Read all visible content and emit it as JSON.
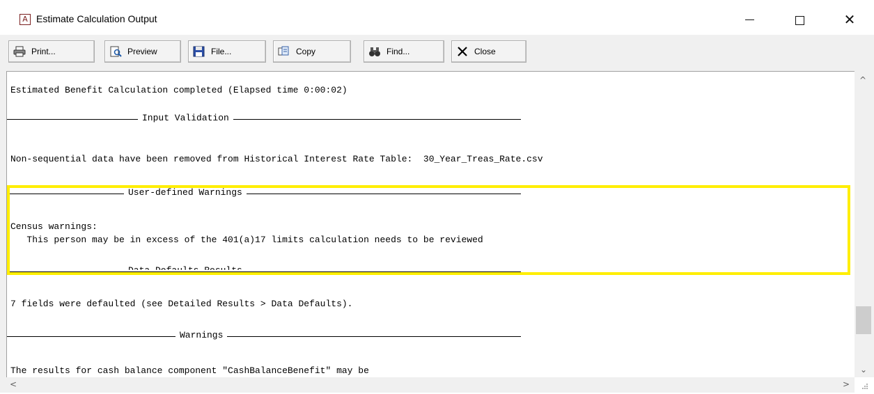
{
  "window": {
    "title": "Estimate Calculation Output",
    "app_icon_letter": "A",
    "controls": {
      "minimize": "minimize",
      "maximize": "maximize",
      "close": "✕"
    }
  },
  "toolbar": {
    "buttons": [
      {
        "label": "Print...",
        "icon": "printer-icon"
      },
      {
        "label": "Preview",
        "icon": "preview-icon"
      },
      {
        "label": "File...",
        "icon": "floppy-disk-icon"
      },
      {
        "label": "Copy",
        "icon": "copy-icon"
      },
      {
        "label": "Find...",
        "icon": "binoculars-icon"
      },
      {
        "label": "Close",
        "icon": "close-x-icon"
      }
    ]
  },
  "output": {
    "completed_line": "Estimated Benefit Calculation completed (Elapsed time 0:00:02)",
    "sections": [
      {
        "title": "Input Validation"
      },
      {
        "title": "User-defined Warnings"
      },
      {
        "title": "Data Defaults Results"
      },
      {
        "title": "Warnings"
      }
    ],
    "input_validation_msg": "Non-sequential data have been removed from Historical Interest Rate Table:  30_Year_Treas_Rate.csv",
    "census_heading": "Census warnings:",
    "census_detail": "   This person may be in excess of the 401(a)17 limits calculation needs to be reviewed",
    "defaults_msg": "7 fields were defaulted (see Detailed Results > Data Defaults).",
    "warnings_msg": "The results for cash balance component \"CashBalanceBenefit\" may be"
  },
  "colors": {
    "highlight": "#ffee00",
    "window_bg": "#f0f0f0",
    "content_bg": "#ffffff"
  }
}
